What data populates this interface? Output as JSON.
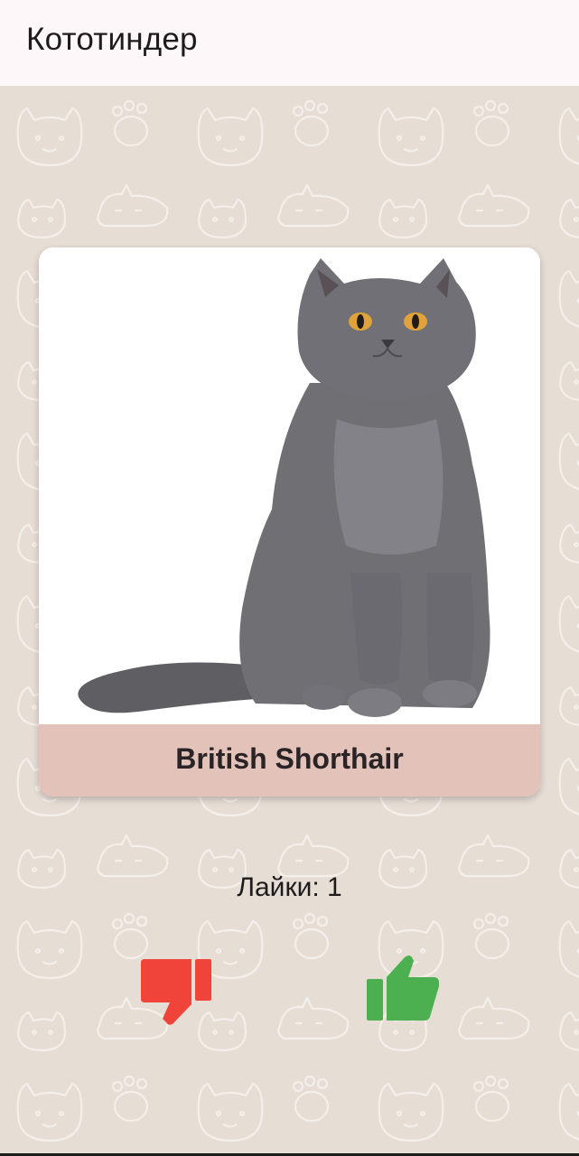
{
  "app_bar": {
    "title": "Кототиндер"
  },
  "card": {
    "breed": "British Shorthair"
  },
  "likes": {
    "text": "Лайки: 1"
  },
  "actions": {
    "dislike_icon": "thumb-down-icon",
    "like_icon": "thumb-up-icon"
  },
  "colors": {
    "background": "#e6ddd5",
    "pattern_stroke": "#f4efea",
    "breed_band": "#e3c2ba",
    "dislike": "#f0443a",
    "like": "#4caf50"
  }
}
